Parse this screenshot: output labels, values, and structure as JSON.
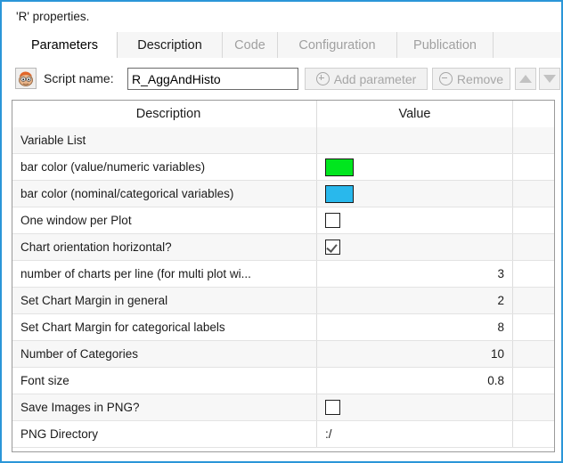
{
  "window": {
    "title": "'R' properties.",
    "border_color": "#2a96d8"
  },
  "tabs": [
    {
      "label": "Parameters",
      "state": "active"
    },
    {
      "label": "Description",
      "state": "enabled"
    },
    {
      "label": "Code",
      "state": "disabled"
    },
    {
      "label": "Configuration",
      "state": "disabled"
    },
    {
      "label": "Publication",
      "state": "disabled"
    }
  ],
  "toolbar": {
    "script_icon": "script-face-icon",
    "script_name_label": "Script name:",
    "script_name_value": "R_AggAndHisto",
    "script_name_placeholder": "",
    "add_parameter_label": "Add parameter",
    "remove_label": "Remove",
    "move_up_icon": "triangle-up-icon",
    "move_down_icon": "triangle-down-icon"
  },
  "table": {
    "columns": [
      "Description",
      "Value"
    ],
    "rows": [
      {
        "description": "Variable List",
        "type": "text",
        "value": ""
      },
      {
        "description": "bar color (value/numeric variables)",
        "type": "color",
        "value": "#00e61e"
      },
      {
        "description": "bar color (nominal/categorical variables)",
        "type": "color",
        "value": "#29b8ec"
      },
      {
        "description": "One window per Plot",
        "type": "checkbox",
        "value": false
      },
      {
        "description": "Chart orientation horizontal?",
        "type": "checkbox",
        "value": true
      },
      {
        "description": "number of charts per line (for multi plot wi...",
        "type": "number",
        "value": "3"
      },
      {
        "description": "Set Chart Margin in general",
        "type": "number",
        "value": "2"
      },
      {
        "description": "Set Chart Margin for categorical labels",
        "type": "number",
        "value": "8"
      },
      {
        "description": "Number of Categories",
        "type": "number",
        "value": "10"
      },
      {
        "description": "Font size",
        "type": "number",
        "value": "0.8"
      },
      {
        "description": "Save Images in PNG?",
        "type": "checkbox",
        "value": false
      },
      {
        "description": "PNG Directory",
        "type": "text",
        "value": ":/"
      }
    ]
  }
}
